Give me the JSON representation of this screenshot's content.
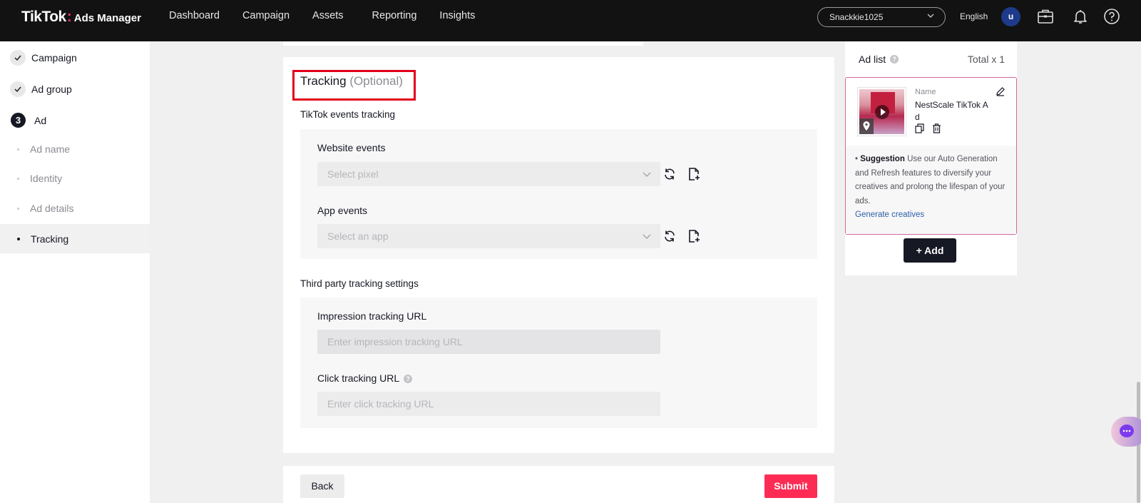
{
  "brand": {
    "name": "TikTok",
    "product": "Ads Manager"
  },
  "nav": {
    "items": [
      "Dashboard",
      "Campaign",
      "Assets",
      "Reporting",
      "Insights"
    ]
  },
  "account": {
    "name": "Snackkie1025"
  },
  "language": "English",
  "user": {
    "initial": "u"
  },
  "icons": {
    "briefcase": "briefcase-icon",
    "bell": "bell-icon",
    "help": "help-icon"
  },
  "sidebar": {
    "steps": [
      {
        "label": "Campaign",
        "state": "done"
      },
      {
        "label": "Ad group",
        "state": "done"
      },
      {
        "label": "Ad",
        "number": "3",
        "state": "current"
      }
    ],
    "subitems": [
      "Ad name",
      "Identity",
      "Ad details",
      "Tracking"
    ],
    "active_subitem": "Tracking"
  },
  "tracking": {
    "title": "Tracking",
    "optional": "(Optional)",
    "tiktok_events_label": "TikTok events tracking",
    "website_events": {
      "label": "Website events",
      "placeholder": "Select pixel"
    },
    "app_events": {
      "label": "App events",
      "placeholder": "Select an app"
    },
    "third_party_label": "Third party tracking settings",
    "impression_url": {
      "label": "Impression tracking URL",
      "placeholder": "Enter impression tracking URL"
    },
    "click_url": {
      "label": "Click tracking URL",
      "placeholder": "Enter click tracking URL"
    }
  },
  "actions": {
    "back": "Back",
    "submit": "Submit"
  },
  "adlist": {
    "title": "Ad list",
    "total": "Total x 1",
    "ad": {
      "name_label": "Name",
      "name": "NestScale TikTok Ad"
    },
    "suggestion": {
      "bold": "Suggestion",
      "text": "Use our Auto Generation and Refresh features to diversify your creatives and prolong the lifespan of your ads.",
      "link": "Generate creatives"
    },
    "add_button": "+ Add"
  },
  "colors": {
    "topbar": "#121212",
    "primary": "#fe2c55",
    "highlight": "#e3001b",
    "accent_border": "#d4679f",
    "link": "#2d5ea8"
  }
}
